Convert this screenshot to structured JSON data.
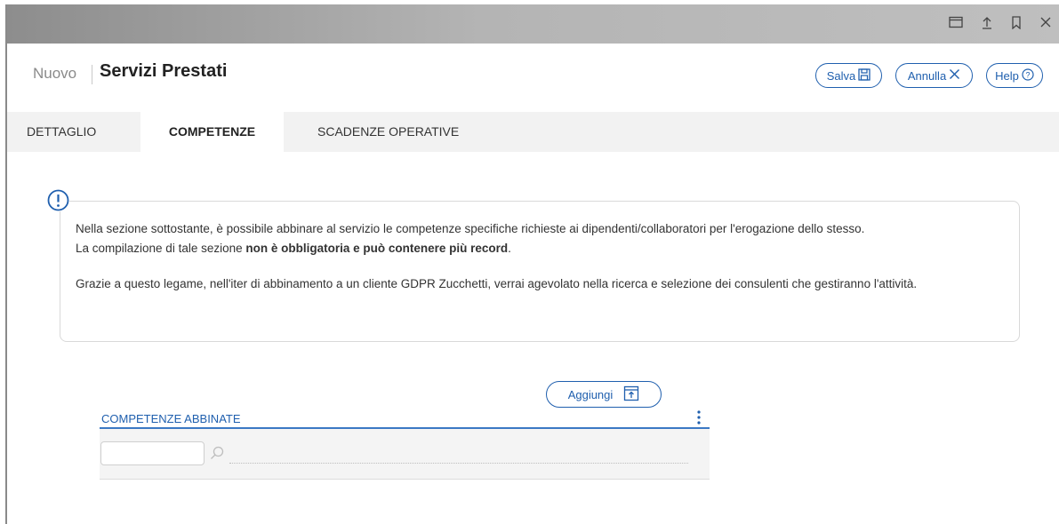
{
  "window_controls": {
    "icons": [
      "window-icon",
      "upload-icon",
      "bookmark-icon",
      "close-icon"
    ]
  },
  "header": {
    "breadcrumb_new": "Nuovo",
    "title": "Servizi Prestati",
    "save_label": "Salva",
    "cancel_label": "Annulla",
    "help_label": "Help"
  },
  "tabs": [
    {
      "label": "DETTAGLIO",
      "active": false
    },
    {
      "label": "COMPETENZE",
      "active": true
    },
    {
      "label": "SCADENZE OPERATIVE",
      "active": false
    }
  ],
  "info": {
    "line1": "Nella sezione sottostante, è possibile abbinare al servizio le competenze specifiche richieste ai dipendenti/collaboratori per l'erogazione dello stesso.",
    "line2_prefix": "La compilazione di tale sezione ",
    "line2_bold": "non è obbligatoria e può contenere più record",
    "line2_suffix": ".",
    "paragraph2": "Grazie a questo legame, nell'iter di abbinamento a un cliente GDPR Zucchetti, verrai agevolato nella ricerca e selezione dei consulenti che gestiranno l'attività."
  },
  "grid": {
    "add_label": "Aggiungi",
    "title": "COMPETENZE ABBINATE",
    "filter_value": ""
  },
  "colors": {
    "accent": "#1f5fae",
    "titlebar": "#b4b4b4",
    "tabbar": "#f2f2f2"
  }
}
